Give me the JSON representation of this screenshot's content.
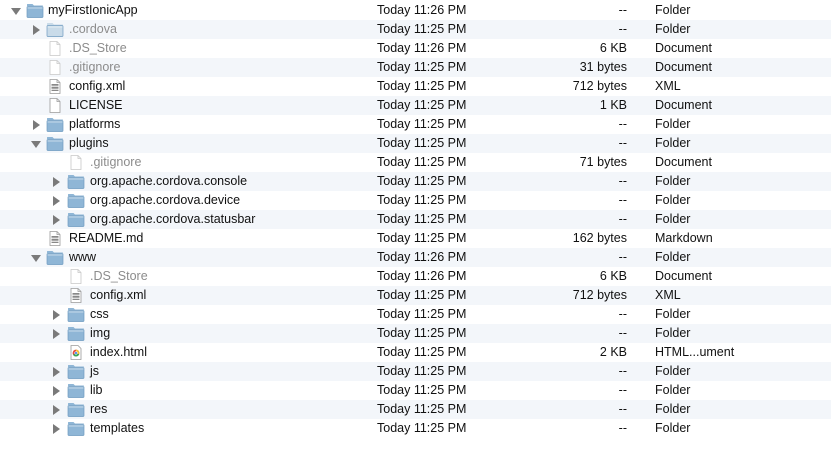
{
  "rows": [
    {
      "name": "myFirstIonicApp",
      "date": "Today 11:26 PM",
      "size": "--",
      "kind": "Folder",
      "level": 0,
      "disclosure": "open",
      "icon": "folder-icon",
      "dim": false
    },
    {
      "name": ".cordova",
      "date": "Today 11:25 PM",
      "size": "--",
      "kind": "Folder",
      "level": 1,
      "disclosure": "closed",
      "icon": "folder-icon",
      "dim": true
    },
    {
      "name": ".DS_Store",
      "date": "Today 11:26 PM",
      "size": "6 KB",
      "kind": "Document",
      "level": 1,
      "disclosure": "none",
      "icon": "blank-document-icon",
      "dim": true
    },
    {
      "name": ".gitignore",
      "date": "Today 11:25 PM",
      "size": "31 bytes",
      "kind": "Document",
      "level": 1,
      "disclosure": "none",
      "icon": "blank-document-icon",
      "dim": true
    },
    {
      "name": "config.xml",
      "date": "Today 11:25 PM",
      "size": "712 bytes",
      "kind": "XML",
      "level": 1,
      "disclosure": "none",
      "icon": "text-document-icon",
      "dim": false
    },
    {
      "name": "LICENSE",
      "date": "Today 11:25 PM",
      "size": "1 KB",
      "kind": "Document",
      "level": 1,
      "disclosure": "none",
      "icon": "blank-document-icon",
      "dim": false
    },
    {
      "name": "platforms",
      "date": "Today 11:25 PM",
      "size": "--",
      "kind": "Folder",
      "level": 1,
      "disclosure": "closed",
      "icon": "folder-icon",
      "dim": false
    },
    {
      "name": "plugins",
      "date": "Today 11:25 PM",
      "size": "--",
      "kind": "Folder",
      "level": 1,
      "disclosure": "open",
      "icon": "folder-icon",
      "dim": false
    },
    {
      "name": ".gitignore",
      "date": "Today 11:25 PM",
      "size": "71 bytes",
      "kind": "Document",
      "level": 2,
      "disclosure": "none",
      "icon": "blank-document-icon",
      "dim": true
    },
    {
      "name": "org.apache.cordova.console",
      "date": "Today 11:25 PM",
      "size": "--",
      "kind": "Folder",
      "level": 2,
      "disclosure": "closed",
      "icon": "folder-icon",
      "dim": false
    },
    {
      "name": "org.apache.cordova.device",
      "date": "Today 11:25 PM",
      "size": "--",
      "kind": "Folder",
      "level": 2,
      "disclosure": "closed",
      "icon": "folder-icon",
      "dim": false
    },
    {
      "name": "org.apache.cordova.statusbar",
      "date": "Today 11:25 PM",
      "size": "--",
      "kind": "Folder",
      "level": 2,
      "disclosure": "closed",
      "icon": "folder-icon",
      "dim": false
    },
    {
      "name": "README.md",
      "date": "Today 11:25 PM",
      "size": "162 bytes",
      "kind": "Markdown",
      "level": 1,
      "disclosure": "none",
      "icon": "text-document-icon",
      "dim": false
    },
    {
      "name": "www",
      "date": "Today 11:26 PM",
      "size": "--",
      "kind": "Folder",
      "level": 1,
      "disclosure": "open",
      "icon": "folder-icon",
      "dim": false
    },
    {
      "name": ".DS_Store",
      "date": "Today 11:26 PM",
      "size": "6 KB",
      "kind": "Document",
      "level": 2,
      "disclosure": "none",
      "icon": "blank-document-icon",
      "dim": true
    },
    {
      "name": "config.xml",
      "date": "Today 11:25 PM",
      "size": "712 bytes",
      "kind": "XML",
      "level": 2,
      "disclosure": "none",
      "icon": "text-document-icon",
      "dim": false
    },
    {
      "name": "css",
      "date": "Today 11:25 PM",
      "size": "--",
      "kind": "Folder",
      "level": 2,
      "disclosure": "closed",
      "icon": "folder-icon",
      "dim": false
    },
    {
      "name": "img",
      "date": "Today 11:25 PM",
      "size": "--",
      "kind": "Folder",
      "level": 2,
      "disclosure": "closed",
      "icon": "folder-icon",
      "dim": false
    },
    {
      "name": "index.html",
      "date": "Today 11:25 PM",
      "size": "2 KB",
      "kind": "HTML...ument",
      "level": 2,
      "disclosure": "none",
      "icon": "html-document-icon",
      "dim": false
    },
    {
      "name": "js",
      "date": "Today 11:25 PM",
      "size": "--",
      "kind": "Folder",
      "level": 2,
      "disclosure": "closed",
      "icon": "folder-icon",
      "dim": false
    },
    {
      "name": "lib",
      "date": "Today 11:25 PM",
      "size": "--",
      "kind": "Folder",
      "level": 2,
      "disclosure": "closed",
      "icon": "folder-icon",
      "dim": false
    },
    {
      "name": "res",
      "date": "Today 11:25 PM",
      "size": "--",
      "kind": "Folder",
      "level": 2,
      "disclosure": "closed",
      "icon": "folder-icon",
      "dim": false
    },
    {
      "name": "templates",
      "date": "Today 11:25 PM",
      "size": "--",
      "kind": "Folder",
      "level": 2,
      "disclosure": "closed",
      "icon": "folder-icon",
      "dim": false
    }
  ],
  "colors": {
    "row_alt": "#f3f6fa",
    "folder": "#8fb6d6",
    "folder_dim": "#c9dbe9",
    "dim_text": "#8c8c8c"
  }
}
